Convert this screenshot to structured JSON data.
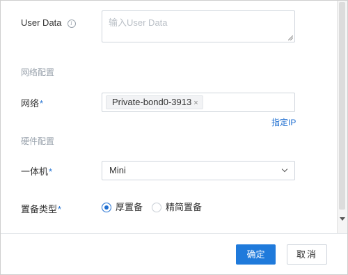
{
  "form": {
    "user_data": {
      "label": "User Data",
      "info_icon": "i",
      "placeholder": "输入User Data",
      "value": ""
    },
    "network_section": {
      "title": "网络配置"
    },
    "network": {
      "label": "网络",
      "required_mark": "*",
      "tag_value": "Private-bond0-3913",
      "tag_close": "×",
      "assign_ip_link": "指定IP"
    },
    "hardware_section": {
      "title": "硬件配置"
    },
    "appliance": {
      "label": "一体机",
      "required_mark": "*",
      "selected": "Mini"
    },
    "provision_type": {
      "label": "置备类型",
      "required_mark": "*",
      "options": [
        {
          "label": "厚置备",
          "checked": true
        },
        {
          "label": "精简置备",
          "checked": false
        }
      ]
    }
  },
  "footer": {
    "confirm_label": "确定",
    "cancel_label": "取消"
  },
  "colors": {
    "accent": "#1f7adb",
    "link": "#1f6fd1",
    "section_text": "#9aa3ad",
    "border": "#cfd5dc"
  }
}
